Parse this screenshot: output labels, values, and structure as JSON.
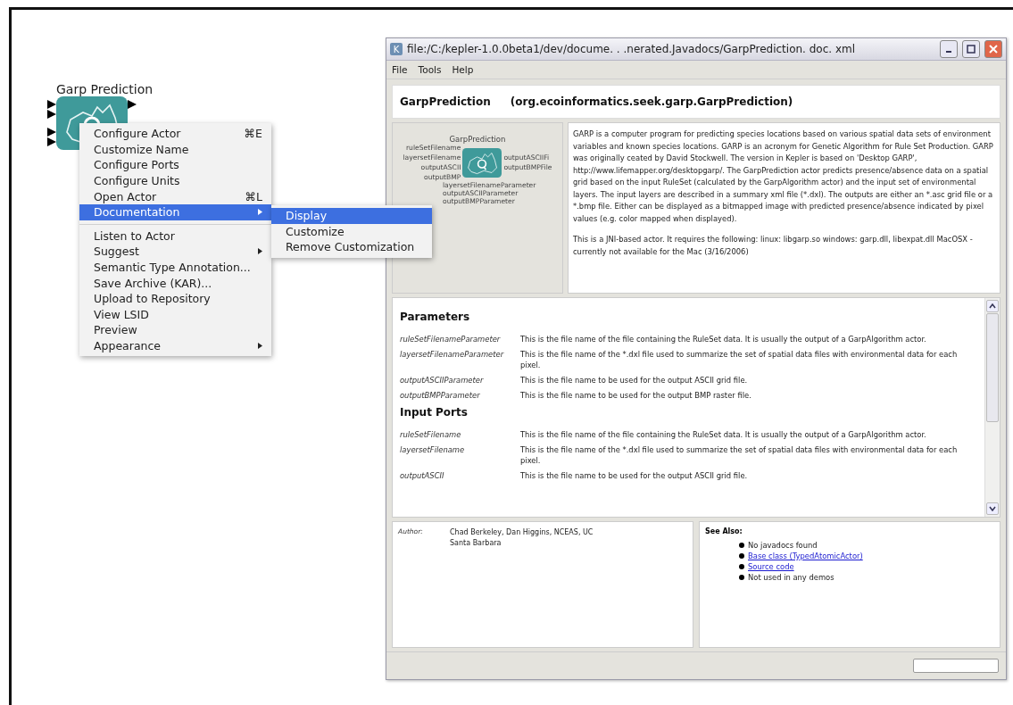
{
  "actor": {
    "title": "Garp Prediction"
  },
  "context_menu": {
    "items": [
      {
        "kind": "item",
        "label": "Configure Actor",
        "shortcut": "⌘E",
        "selected": false
      },
      {
        "kind": "item",
        "label": "Customize Name",
        "selected": false
      },
      {
        "kind": "item",
        "label": "Configure Ports",
        "selected": false
      },
      {
        "kind": "item",
        "label": "Configure Units",
        "selected": false
      },
      {
        "kind": "item",
        "label": "Open Actor",
        "shortcut": "⌘L",
        "selected": false
      },
      {
        "kind": "submenu",
        "label": "Documentation",
        "selected": true
      },
      {
        "kind": "separator"
      },
      {
        "kind": "item",
        "label": "Listen to Actor",
        "selected": false
      },
      {
        "kind": "submenu",
        "label": "Suggest",
        "selected": false
      },
      {
        "kind": "item",
        "label": "Semantic Type Annotation...",
        "selected": false
      },
      {
        "kind": "item",
        "label": "Save Archive (KAR)...",
        "selected": false
      },
      {
        "kind": "item",
        "label": "Upload to Repository",
        "selected": false
      },
      {
        "kind": "item",
        "label": "View LSID",
        "selected": false
      },
      {
        "kind": "item",
        "label": "Preview",
        "selected": false
      },
      {
        "kind": "submenu",
        "label": "Appearance",
        "selected": false
      }
    ]
  },
  "submenu": {
    "items": [
      {
        "label": "Display",
        "selected": true
      },
      {
        "label": "Customize",
        "selected": false
      },
      {
        "label": "Remove Customization",
        "selected": false
      }
    ]
  },
  "window": {
    "icon_letter": "K",
    "title": "file:/C:/kepler-1.0.0beta1/dev/docume. . .nerated.Javadocs/GarpPrediction. doc. xml",
    "menu": [
      "File",
      "Tools",
      "Help"
    ],
    "heading": {
      "name": "GarpPrediction",
      "class": "(org.ecoinformatics.seek.garp.GarpPrediction)"
    },
    "diagram": {
      "title": "GarpPrediction",
      "inputs": [
        "ruleSetFilename",
        "layersetFilename",
        "outputASCII",
        "outputBMP"
      ],
      "outputs": [
        "outputASCIIFi",
        "outputBMPFile"
      ],
      "parameters": [
        "layersetFilenameParameter",
        "outputASCIIParameter",
        "outputBMPParameter"
      ]
    },
    "description": [
      "GARP is a computer program for predicting species locations based on various spatial data sets of environment variables and known species locations. GARP is an acronym for Genetic Algorithm for Rule Set Production. GARP was originally ceated by David Stockwell. The version in Kepler is based on 'Desktop GARP', http://www.lifemapper.org/desktopgarp/. The GarpPrediction actor predicts presence/absence data on a spatial grid based on the input RuleSet (calculated by the GarpAlgorithm actor) and the input set of environmental layers. The input layers are described in a summary xml file (*.dxl). The outputs are either an *.asc grid file or a *.bmp file. Either can be displayed as a bitmapped image with predicted presence/absence indicated by pixel values (e.g. color mapped when displayed).",
      "This is a JNI-based actor. It requires the following: linux: libgarp.so windows: garp.dll, libexpat.dll MacOSX - currently not available for the Mac (3/16/2006)"
    ],
    "sections": [
      {
        "title": "Parameters",
        "rows": [
          {
            "name": "ruleSetFilenameParameter",
            "text": "This is the file name of the file containing the RuleSet data. It is usually the output of a GarpAlgorithm actor."
          },
          {
            "name": "layersetFilenameParameter",
            "text": "This is the file name of the *.dxl file used to summarize the set of spatial data files with environmental data for each pixel."
          },
          {
            "name": "outputASCIIParameter",
            "text": "This is the file name to be used for the output ASCII grid file."
          },
          {
            "name": "outputBMPParameter",
            "text": "This is the file name to be used for the output BMP raster file."
          }
        ]
      },
      {
        "title": "Input Ports",
        "rows": [
          {
            "name": "ruleSetFilename",
            "text": "This is the file name of the file containing the RuleSet data. It is usually the output of a GarpAlgorithm actor."
          },
          {
            "name": "layersetFilename",
            "text": "This is the file name of the *.dxl file used to summarize the set of spatial data files with environmental data for each pixel."
          },
          {
            "name": "outputASCII",
            "text": "This is the file name to be used for the output ASCII grid file."
          }
        ]
      }
    ],
    "author": {
      "label": "Author:",
      "value": "Chad Berkeley, Dan Higgins, NCEAS, UC Santa Barbara"
    },
    "see_also": {
      "title": "See Also:",
      "items": [
        {
          "kind": "text",
          "label": "No javadocs found"
        },
        {
          "kind": "link",
          "label": "Base class (TypedAtomicActor)"
        },
        {
          "kind": "link",
          "label": "Source code"
        },
        {
          "kind": "text",
          "label": "Not used in any demos"
        }
      ]
    }
  }
}
